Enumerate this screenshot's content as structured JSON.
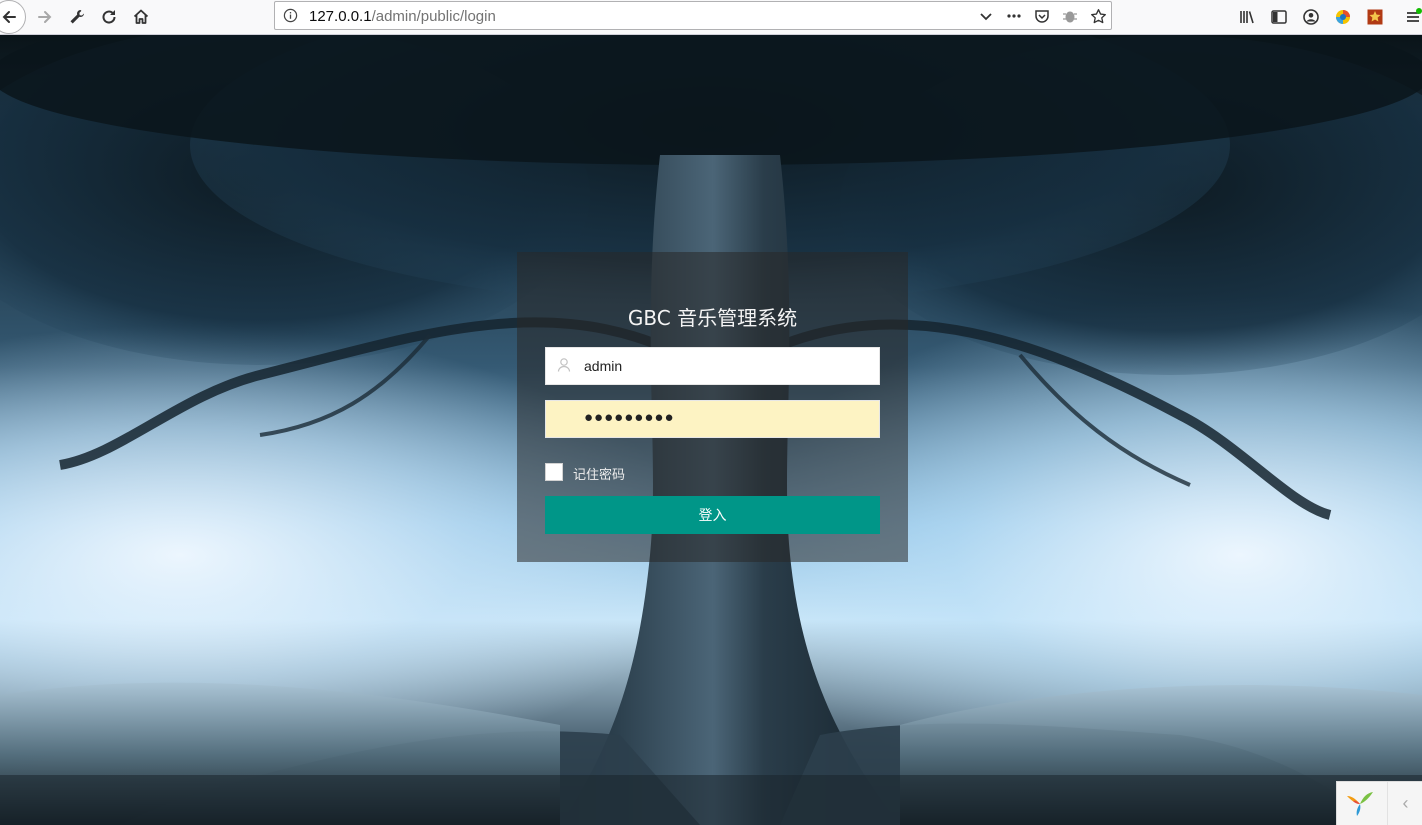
{
  "browser": {
    "url_host": "127.0.0.1",
    "url_path": "/admin/public/login",
    "icons": [
      "back-arrow-icon",
      "forward-arrow-icon",
      "wrench-icon",
      "reload-icon",
      "home-icon",
      "info-icon",
      "chevron-down-icon",
      "more-dots-icon",
      "pocket-icon",
      "extension-icon",
      "star-icon",
      "library-icon",
      "sidebar-icon",
      "account-icon",
      "color-extension-icon",
      "red-extension-icon",
      "menu-icon"
    ]
  },
  "login": {
    "title": "GBC 音乐管理系统",
    "username_value": "admin",
    "password_value": "●●●●●●●●●",
    "remember_label": "记住密码",
    "remember_checked": false,
    "submit_label": "登入",
    "accent_color": "#009688",
    "password_bg": "#fdf3c3"
  },
  "corner_widget": {
    "arrow": "‹"
  }
}
